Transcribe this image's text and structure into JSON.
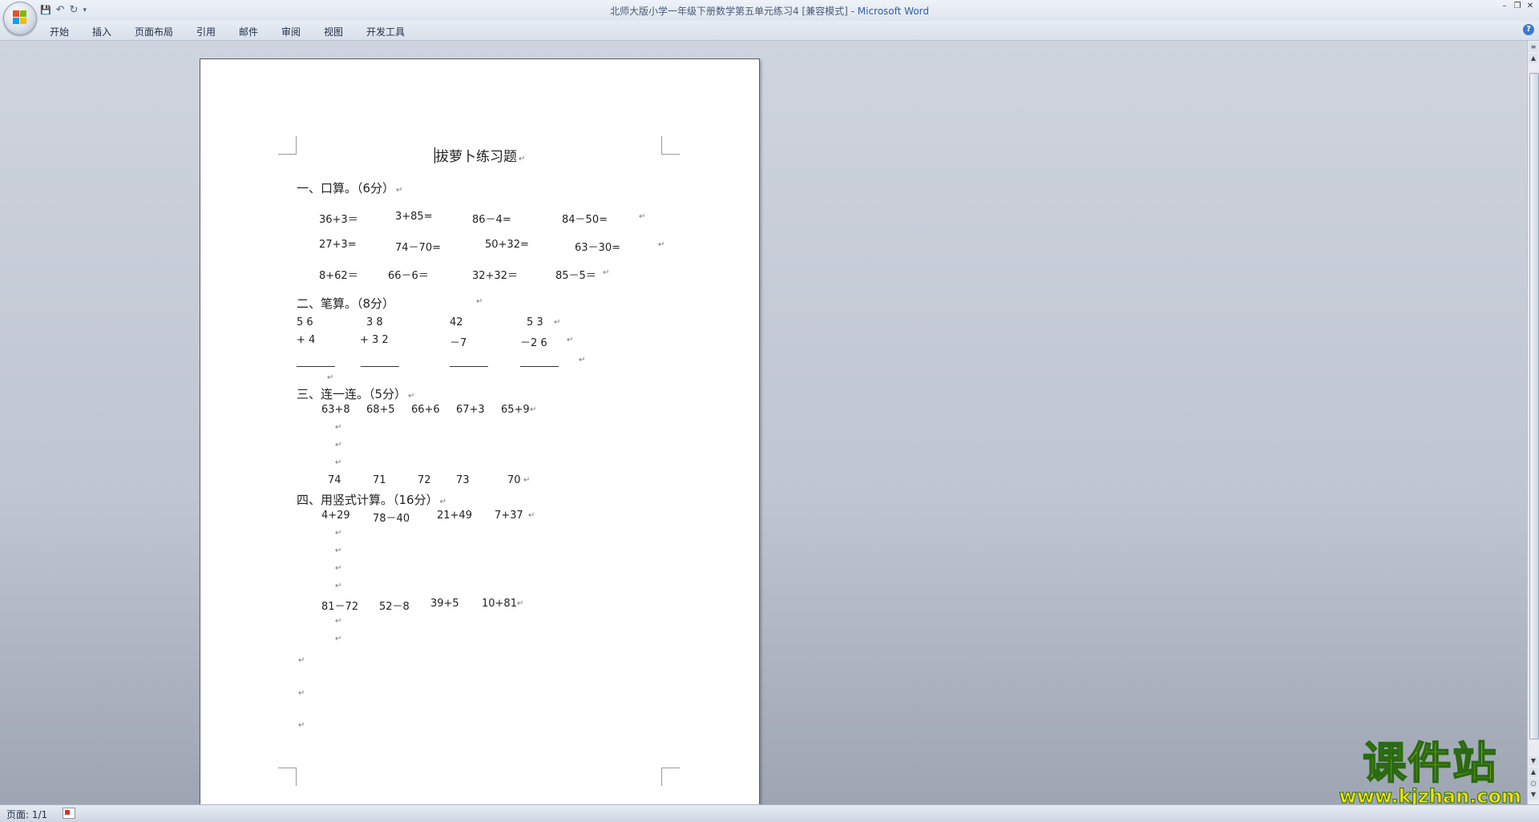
{
  "window": {
    "title_doc": "北师大版小学一年级下册数学第五单元练习4 [兼容模式] - ",
    "title_app": "Microsoft Word",
    "controls": [
      "–",
      "❐",
      "✕"
    ]
  },
  "quick_access": {
    "save": "💾",
    "undo": "↶",
    "redo": "↻",
    "more": "▾"
  },
  "tabs": [
    "开始",
    "插入",
    "页面布局",
    "引用",
    "邮件",
    "审阅",
    "视图",
    "开发工具"
  ],
  "help": "?",
  "document": {
    "title": "拔萝卜练习题",
    "sec1": {
      "heading": "一、口算。（6分）",
      "rows": [
        [
          "36+3＝",
          "3+85=",
          "86－4=",
          "84－50="
        ],
        [
          "27+3=",
          "74－70=",
          "50+32=",
          "63－30="
        ],
        [
          "8+62＝",
          "66－6＝",
          "32+32＝",
          "85－5＝"
        ]
      ]
    },
    "sec2": {
      "heading": "二、笔算。（8分）",
      "top": [
        "5 6",
        "3 8",
        "42",
        "5 3"
      ],
      "bottom": [
        "+ 4",
        "+ 3 2",
        "－7",
        "－2 6"
      ]
    },
    "sec3": {
      "heading": "三、连一连。（5分）",
      "exprs": [
        "63+8",
        "68+5",
        "66+6",
        "67+3",
        "65+9"
      ],
      "answers": [
        "74",
        "71",
        "72",
        "73",
        "70"
      ]
    },
    "sec4": {
      "heading": "四、用竖式计算。（16分）",
      "row1": [
        "4+29",
        "78－40",
        "21+49",
        "7+37"
      ],
      "row2": [
        "81－72",
        "52－8",
        "39+5",
        "10+81"
      ]
    },
    "para_mark": "↵"
  },
  "status": {
    "page": "页面: 1/1"
  },
  "watermark": {
    "line1": "课件站",
    "line2": "www.kjzhan.com"
  }
}
